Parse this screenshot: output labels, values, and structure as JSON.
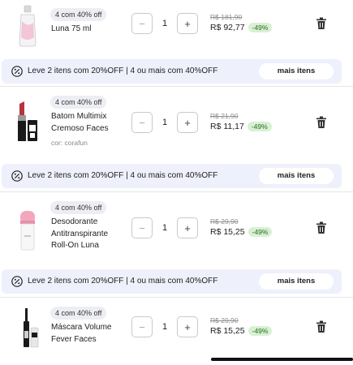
{
  "items": [
    {
      "badge": "4 com 40% off",
      "name": "Luna 75 ml",
      "variant": "",
      "qty": "1",
      "minus": "−",
      "plus": "+",
      "old_price": "R$ 181,90",
      "new_price": "R$ 92,77",
      "discount": "-49%",
      "thumb_icon": "perfume-bottle-icon"
    },
    {
      "badge": "4 com 40% off",
      "name": "Batom Multimix Cremoso Faces",
      "variant": "cor: corafun",
      "qty": "1",
      "minus": "−",
      "plus": "+",
      "old_price": "R$ 21,90",
      "new_price": "R$ 11,17",
      "discount": "-49%",
      "thumb_icon": "lipstick-icon"
    },
    {
      "badge": "4 com 40% off",
      "name": "Desodorante Antitranspirante Roll-On Luna",
      "variant": "",
      "qty": "1",
      "minus": "−",
      "plus": "+",
      "old_price": "R$ 29,90",
      "new_price": "R$ 15,25",
      "discount": "-49%",
      "thumb_icon": "roll-on-icon"
    },
    {
      "badge": "4 com 40% off",
      "name": "Máscara Volume Fever Faces",
      "variant": "",
      "qty": "1",
      "minus": "−",
      "plus": "+",
      "old_price": "R$ 29,90",
      "new_price": "R$ 15,25",
      "discount": "-49%",
      "thumb_icon": "mascara-icon"
    }
  ],
  "promo": {
    "text": "Leve 2 itens com 20%OFF | 4 ou mais com 40%OFF",
    "button": "mais itens",
    "icon": "percent-icon"
  },
  "colors": {
    "promo_bg": "#eef0fb",
    "discount_bg": "#d9f0d4",
    "discount_text": "#2a6a25",
    "badge_bg": "#eceef3"
  }
}
